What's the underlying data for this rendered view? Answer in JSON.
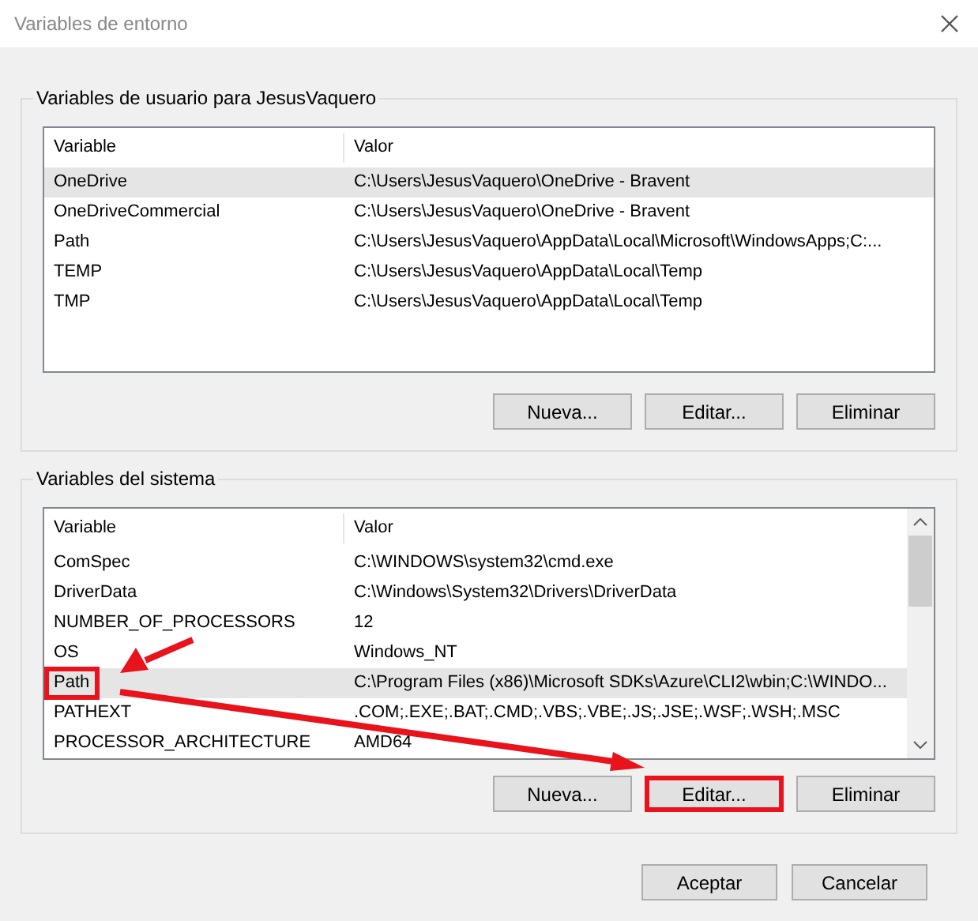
{
  "window": {
    "title": "Variables de entorno"
  },
  "user_variables": {
    "title": "Variables de usuario para JesusVaquero",
    "columns": [
      "Variable",
      "Valor"
    ],
    "rows": [
      {
        "name": "OneDrive",
        "value": "C:\\Users\\JesusVaquero\\OneDrive - Bravent",
        "selected": true,
        "highlighted": false
      },
      {
        "name": "OneDriveCommercial",
        "value": "C:\\Users\\JesusVaquero\\OneDrive - Bravent",
        "selected": false,
        "highlighted": false
      },
      {
        "name": "Path",
        "value": "C:\\Users\\JesusVaquero\\AppData\\Local\\Microsoft\\WindowsApps;C:...",
        "selected": false,
        "highlighted": false
      },
      {
        "name": "TEMP",
        "value": "C:\\Users\\JesusVaquero\\AppData\\Local\\Temp",
        "selected": false,
        "highlighted": false
      },
      {
        "name": "TMP",
        "value": "C:\\Users\\JesusVaquero\\AppData\\Local\\Temp",
        "selected": false,
        "highlighted": false
      }
    ],
    "buttons": [
      {
        "label": "Nueva...",
        "highlighted": false
      },
      {
        "label": "Editar...",
        "highlighted": false
      },
      {
        "label": "Eliminar",
        "highlighted": false
      }
    ]
  },
  "system_variables": {
    "title": "Variables del sistema",
    "columns": [
      "Variable",
      "Valor"
    ],
    "rows": [
      {
        "name": "ComSpec",
        "value": "C:\\WINDOWS\\system32\\cmd.exe",
        "selected": false,
        "highlighted": false
      },
      {
        "name": "DriverData",
        "value": "C:\\Windows\\System32\\Drivers\\DriverData",
        "selected": false,
        "highlighted": false
      },
      {
        "name": "NUMBER_OF_PROCESSORS",
        "value": "12",
        "selected": false,
        "highlighted": false
      },
      {
        "name": "OS",
        "value": "Windows_NT",
        "selected": false,
        "highlighted": false
      },
      {
        "name": "Path",
        "value": "C:\\Program Files (x86)\\Microsoft SDKs\\Azure\\CLI2\\wbin;C:\\WINDO...",
        "selected": true,
        "highlighted": true
      },
      {
        "name": "PATHEXT",
        "value": ".COM;.EXE;.BAT;.CMD;.VBS;.VBE;.JS;.JSE;.WSF;.WSH;.MSC",
        "selected": false,
        "highlighted": false
      },
      {
        "name": "PROCESSOR_ARCHITECTURE",
        "value": "AMD64",
        "selected": false,
        "highlighted": false
      }
    ],
    "buttons": [
      {
        "label": "Nueva...",
        "highlighted": false
      },
      {
        "label": "Editar...",
        "highlighted": true
      },
      {
        "label": "Eliminar",
        "highlighted": false
      }
    ]
  },
  "buttons": [
    {
      "label": "Aceptar"
    },
    {
      "label": "Cancelar"
    }
  ]
}
